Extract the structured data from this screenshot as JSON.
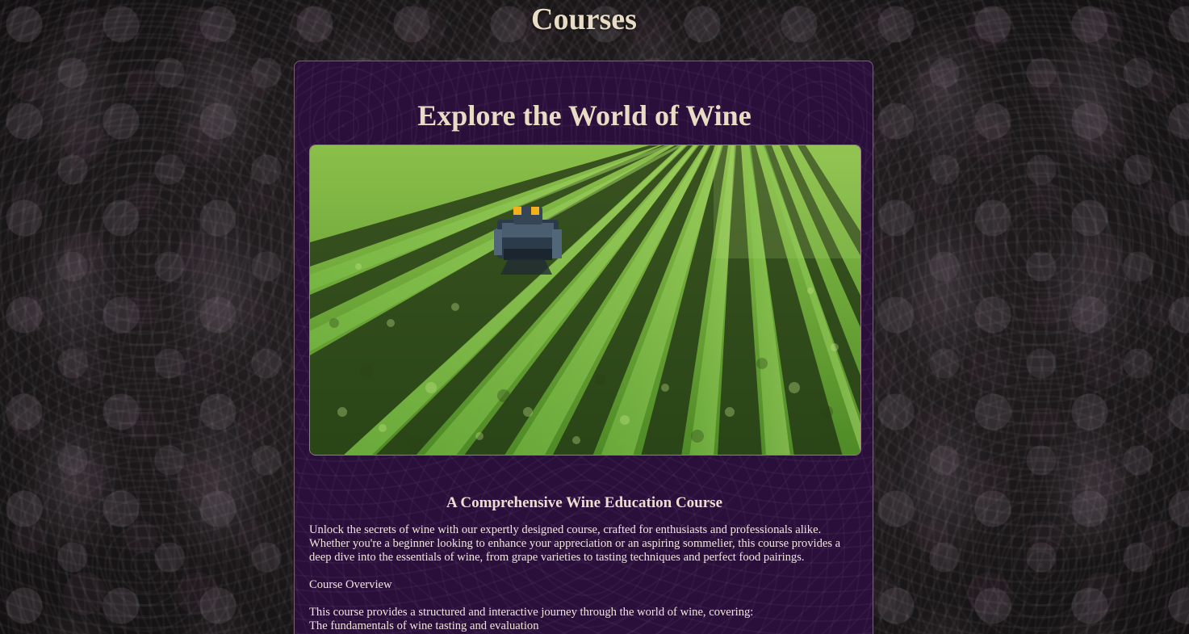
{
  "page": {
    "title": "Courses"
  },
  "card": {
    "heading": "Explore the World of Wine",
    "image_alt": "vineyard-rows-with-harvester",
    "subtitle": "A Comprehensive Wine Education Course",
    "intro": "Unlock the secrets of wine with our expertly designed course, crafted for enthusiasts and professionals alike. Whether you're a beginner looking to enhance your appreciation or an aspiring sommelier, this course provides a deep dive into the essentials of wine, from grape varieties to tasting techniques and perfect food pairings.",
    "overview_label": "Course Overview",
    "overview_text": "This course provides a structured and interactive journey through the world of wine, covering:",
    "list_item_1": "The fundamentals of wine tasting and evaluation"
  },
  "colors": {
    "card_background": "#2a0f3b",
    "card_border": "#7a5f73",
    "title_text": "#e8dcc4",
    "body_text": "#f0e6dc"
  }
}
